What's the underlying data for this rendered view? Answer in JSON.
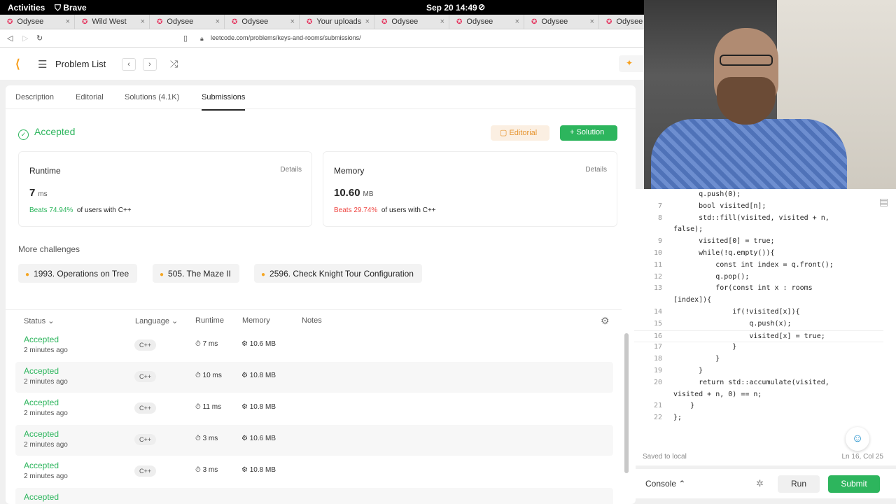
{
  "system": {
    "activities": "Activities",
    "browser": "Brave",
    "clock": "Sep 20  14:49"
  },
  "tabs": [
    "Odysee",
    "Wild West",
    "Odysee",
    "Odysee",
    "Your uploads",
    "Odysee",
    "Odysee",
    "Odysee",
    "Odysee"
  ],
  "url": "leetcode.com/problems/keys-and-rooms/submissions/",
  "header": {
    "problem_list": "Problem List"
  },
  "panel_tabs": [
    "Description",
    "Editorial",
    "Solutions (4.1K)",
    "Submissions"
  ],
  "result": {
    "status": "Accepted",
    "editorial_btn": "Editorial",
    "solution_btn": "Solution"
  },
  "runtime": {
    "title": "Runtime",
    "details": "Details",
    "value": "7",
    "unit": "ms",
    "beats": "Beats 74.94%",
    "suffix": "of users with C++"
  },
  "memory": {
    "title": "Memory",
    "details": "Details",
    "value": "10.60",
    "unit": "MB",
    "beats": "Beats 29.74%",
    "suffix": "of users with C++"
  },
  "more": {
    "title": "More challenges",
    "items": [
      "1993. Operations on Tree",
      "505. The Maze II",
      "2596. Check Knight Tour Configuration"
    ]
  },
  "table": {
    "headers": [
      "Status",
      "Language",
      "Runtime",
      "Memory",
      "Notes"
    ],
    "rows": [
      {
        "status": "Accepted",
        "time": "2 minutes ago",
        "lang": "C++",
        "runtime": "7 ms",
        "memory": "10.6 MB"
      },
      {
        "status": "Accepted",
        "time": "2 minutes ago",
        "lang": "C++",
        "runtime": "10 ms",
        "memory": "10.8 MB"
      },
      {
        "status": "Accepted",
        "time": "2 minutes ago",
        "lang": "C++",
        "runtime": "11 ms",
        "memory": "10.8 MB"
      },
      {
        "status": "Accepted",
        "time": "2 minutes ago",
        "lang": "C++",
        "runtime": "3 ms",
        "memory": "10.6 MB"
      },
      {
        "status": "Accepted",
        "time": "2 minutes ago",
        "lang": "C++",
        "runtime": "3 ms",
        "memory": "10.8 MB"
      },
      {
        "status": "Accepted",
        "time": "",
        "lang": "",
        "runtime": "",
        "memory": ""
      }
    ]
  },
  "code": [
    {
      "n": "",
      "t": "      q.push(0);"
    },
    {
      "n": "7",
      "t": "      bool visited[n];"
    },
    {
      "n": "8",
      "t": "      std::fill(visited, visited + n,"
    },
    {
      "n": "",
      "t": "false);"
    },
    {
      "n": "9",
      "t": "      visited[0] = true;"
    },
    {
      "n": "10",
      "t": "      while(!q.empty()){"
    },
    {
      "n": "11",
      "t": "          const int index = q.front();"
    },
    {
      "n": "12",
      "t": "          q.pop();"
    },
    {
      "n": "13",
      "t": "          for(const int x : rooms"
    },
    {
      "n": "",
      "t": "[index]){"
    },
    {
      "n": "14",
      "t": "              if(!visited[x]){"
    },
    {
      "n": "15",
      "t": "                  q.push(x);"
    },
    {
      "n": "16",
      "t": "                  visited[x] = true;"
    },
    {
      "n": "17",
      "t": "              }"
    },
    {
      "n": "18",
      "t": "          }"
    },
    {
      "n": "19",
      "t": "      }"
    },
    {
      "n": "20",
      "t": "      return std::accumulate(visited,"
    },
    {
      "n": "",
      "t": "visited + n, 0) == n;"
    },
    {
      "n": "21",
      "t": "    }"
    },
    {
      "n": "22",
      "t": "};"
    }
  ],
  "editor_status": {
    "saved": "Saved to local",
    "pos": "Ln 16, Col 25"
  },
  "bottom": {
    "console": "Console",
    "run": "Run",
    "submit": "Submit"
  }
}
